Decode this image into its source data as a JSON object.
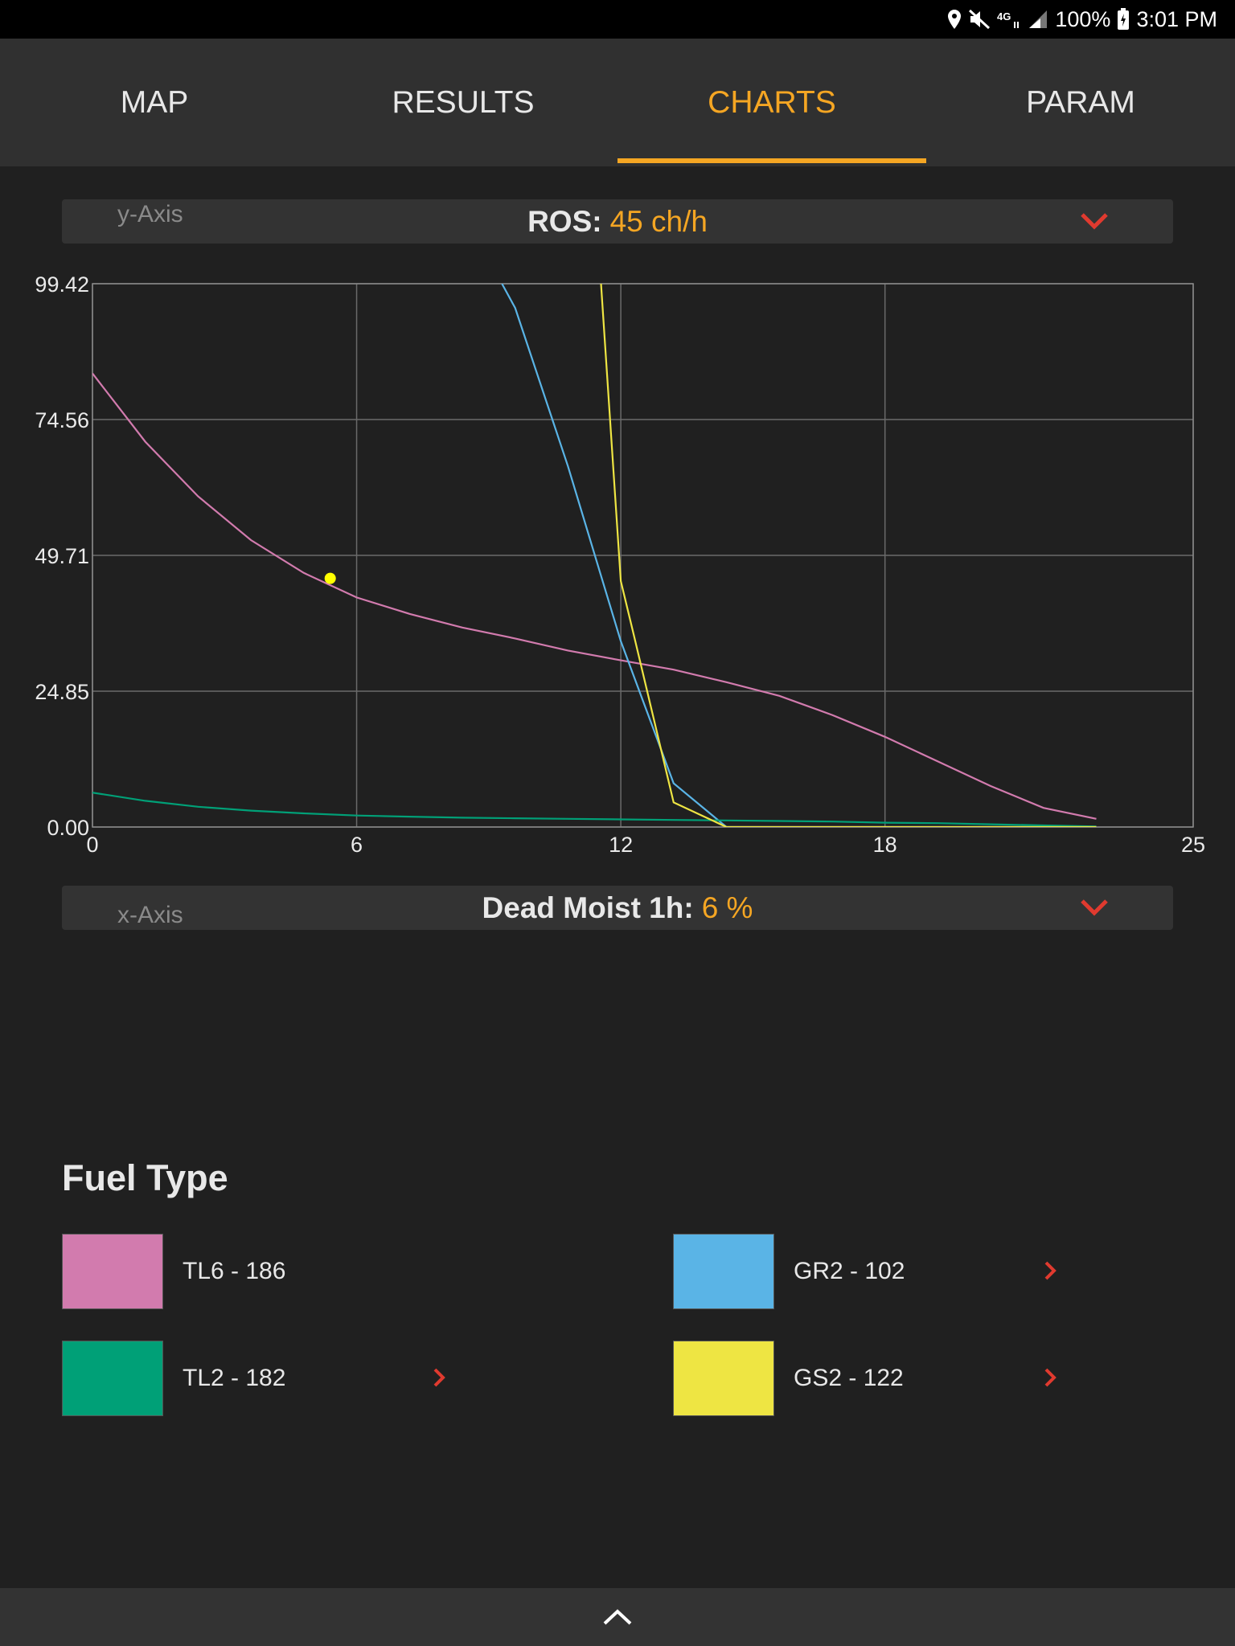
{
  "status_bar": {
    "battery": "100%",
    "time": "3:01 PM",
    "network": "4G",
    "icons": [
      "location-icon",
      "mute-icon",
      "network-4g-icon",
      "signal-icon",
      "battery-charging-icon"
    ]
  },
  "tabs": [
    {
      "label": "MAP",
      "active": false
    },
    {
      "label": "RESULTS",
      "active": false
    },
    {
      "label": "CHARTS",
      "active": true
    },
    {
      "label": "PARAM",
      "active": false
    }
  ],
  "y_axis_selector": {
    "caption": "y-Axis",
    "label": "ROS:",
    "value": "45 ch/h"
  },
  "x_axis_selector": {
    "caption": "x-Axis",
    "label": "Dead Moist 1h:",
    "value": "6 %"
  },
  "colors": {
    "accent": "#f5a623",
    "chevron": "#e03a2f"
  },
  "chart_data": {
    "type": "line",
    "title": "",
    "xlabel": "Dead Moist 1h (%)",
    "ylabel": "ROS (ch/h)",
    "xlim": [
      0,
      25
    ],
    "ylim": [
      0,
      99.42
    ],
    "x_ticks": [
      "0",
      "6",
      "12",
      "18",
      "25"
    ],
    "x_tick_values": [
      0,
      6,
      12,
      18,
      25
    ],
    "y_ticks": [
      "0.00",
      "24.85",
      "49.71",
      "74.56",
      "99.42"
    ],
    "y_tick_values": [
      0,
      24.85,
      49.71,
      74.56,
      99.42
    ],
    "grid": true,
    "marker": {
      "x": 5.4,
      "y": 45.5,
      "color": "#ffff00"
    },
    "series": [
      {
        "name": "TL6 - 186",
        "color": "#d27bae",
        "x": [
          0,
          1.2,
          2.4,
          3.6,
          4.8,
          6,
          7.2,
          8.4,
          9.6,
          10.8,
          12,
          13.2,
          14.4,
          15.6,
          16.8,
          18,
          19.2,
          20.4,
          21.6,
          22.8
        ],
        "y": [
          83,
          70.5,
          60.5,
          52.5,
          46.5,
          42,
          39,
          36.5,
          34.5,
          32.3,
          30.5,
          28.8,
          26.5,
          24,
          20.5,
          16.5,
          12,
          7.5,
          3.5,
          1.5
        ]
      },
      {
        "name": "GR2 - 102",
        "color": "#5ab4e6",
        "x": [
          9.3,
          9.6,
          10.8,
          12,
          13.2,
          14.4,
          22.8
        ],
        "y": [
          99.42,
          95,
          66,
          34,
          8,
          0,
          0
        ]
      },
      {
        "name": "TL2 - 182",
        "color": "#00a077",
        "x": [
          0,
          1.2,
          2.4,
          3.6,
          4.8,
          6,
          7.2,
          8.4,
          9.6,
          10.8,
          12,
          13.2,
          14.4,
          15.6,
          16.8,
          18,
          19.2,
          20.4,
          21.6,
          22.8
        ],
        "y": [
          6.3,
          4.8,
          3.7,
          3,
          2.5,
          2.1,
          1.9,
          1.7,
          1.6,
          1.5,
          1.4,
          1.3,
          1.2,
          1.1,
          1.0,
          0.8,
          0.7,
          0.5,
          0.3,
          0.1
        ]
      },
      {
        "name": "GS2 - 122",
        "color": "#eee543",
        "x": [
          11.55,
          12,
          12.3,
          13.2,
          14.4,
          22.8
        ],
        "y": [
          99.42,
          45,
          35,
          4.5,
          0,
          0
        ]
      }
    ]
  },
  "legend": {
    "title": "Fuel Type",
    "items": [
      {
        "label": "TL6 - 186",
        "color": "#d27bae",
        "has_arrow": false
      },
      {
        "label": "GR2 - 102",
        "color": "#5ab4e6",
        "has_arrow": true
      },
      {
        "label": "TL2 - 182",
        "color": "#00a077",
        "has_arrow": true
      },
      {
        "label": "GS2 - 122",
        "color": "#eee543",
        "has_arrow": true
      }
    ]
  },
  "bottom_bar": {
    "icon": "chevron-up-icon"
  }
}
